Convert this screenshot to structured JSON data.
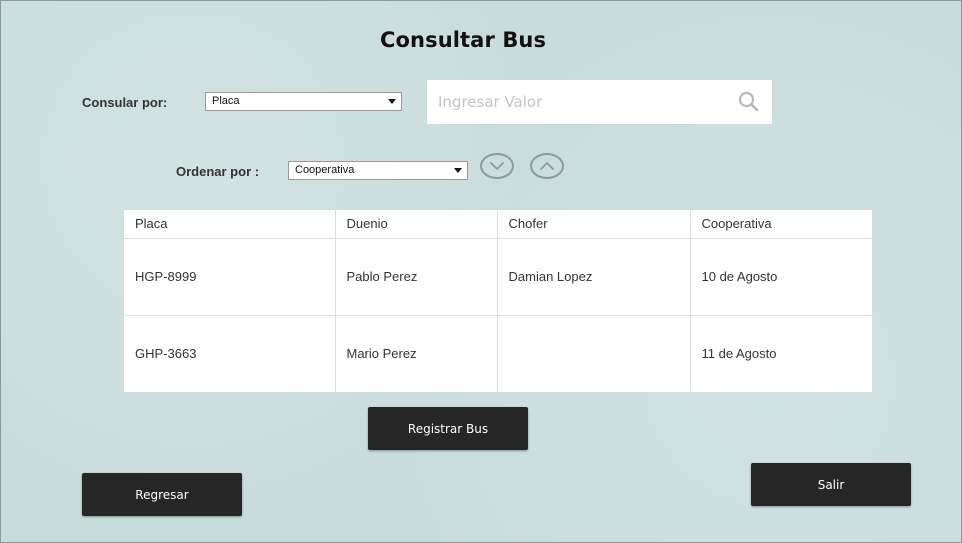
{
  "page": {
    "title": "Consultar Bus"
  },
  "filter": {
    "consultar_label": "Consular por:",
    "consultar_value": "Placa",
    "search_placeholder": "Ingresar Valor",
    "ordenar_label": "Ordenar por :",
    "ordenar_value": "Cooperativa"
  },
  "icons": {
    "search": "search-icon",
    "sort_desc": "chevron-down-icon",
    "sort_asc": "chevron-up-icon"
  },
  "table": {
    "headers": [
      "Placa",
      "Duenio",
      "Chofer",
      "Cooperativa"
    ],
    "rows": [
      [
        "HGP-8999",
        "Pablo Perez",
        "Damian Lopez",
        "10 de Agosto"
      ],
      [
        "GHP-3663",
        "Mario Perez",
        "",
        "11 de Agosto"
      ]
    ]
  },
  "buttons": {
    "registrar": "Registrar Bus",
    "regresar": "Regresar",
    "salir": "Salir"
  },
  "colors": {
    "background": "#c9dcdc",
    "button": "#262626"
  }
}
